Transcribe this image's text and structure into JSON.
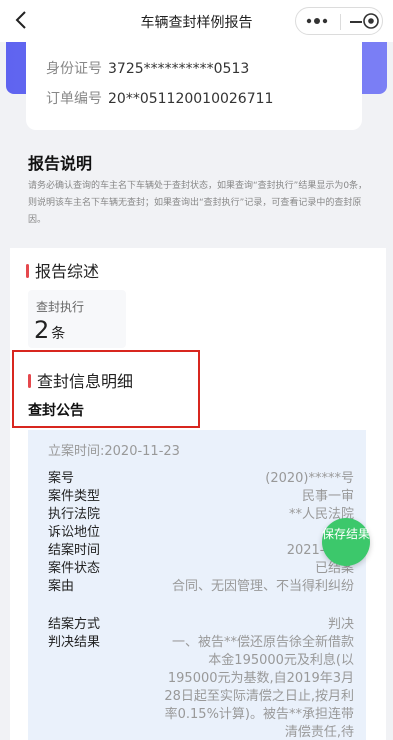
{
  "nav": {
    "title": "车辆查封样例报告"
  },
  "identity": {
    "id_label": "身份证号",
    "id_value": "3725**********0513",
    "order_label": "订单编号",
    "order_value": "20**051120010026711"
  },
  "report_note": {
    "title": "报告说明",
    "text": "请务必确认查询的车主名下车辆处于查封状态，如果查询“查封执行”结果显示为0条，则说明该车主名下车辆无查封；如果查询出“查封执行”记录，可查看记录中的查封原因。"
  },
  "summary": {
    "title": "报告综述",
    "exec_label": "查封执行",
    "exec_count": "2",
    "exec_unit": "条"
  },
  "detail": {
    "title": "查封信息明细",
    "subtitle": "查封公告",
    "filing_time": "立案时间:2020-11-23",
    "fields": [
      {
        "k": "案号",
        "v": "(2020)*****号"
      },
      {
        "k": "案件类型",
        "v": "民事一审"
      },
      {
        "k": "执行法院",
        "v": "**人民法院"
      },
      {
        "k": "诉讼地位",
        "v": "被告"
      },
      {
        "k": "结案时间",
        "v": "2021-02-.."
      },
      {
        "k": "案件状态",
        "v": "已结案"
      },
      {
        "k": "案由",
        "v": "合同、无因管理、不当得利纠纷"
      },
      {
        "k": "结案方式",
        "v": "判决"
      },
      {
        "k": "判决结果",
        "v": "一、被告**偿还原告徐全新借款本金195000元及利息(以195000元为基数,自2019年3月28日起至实际清偿之日止,按月利率0.15%计算)。被告**承担连带清偿责任,待"
      }
    ]
  },
  "fab": {
    "label": "保存结果"
  }
}
